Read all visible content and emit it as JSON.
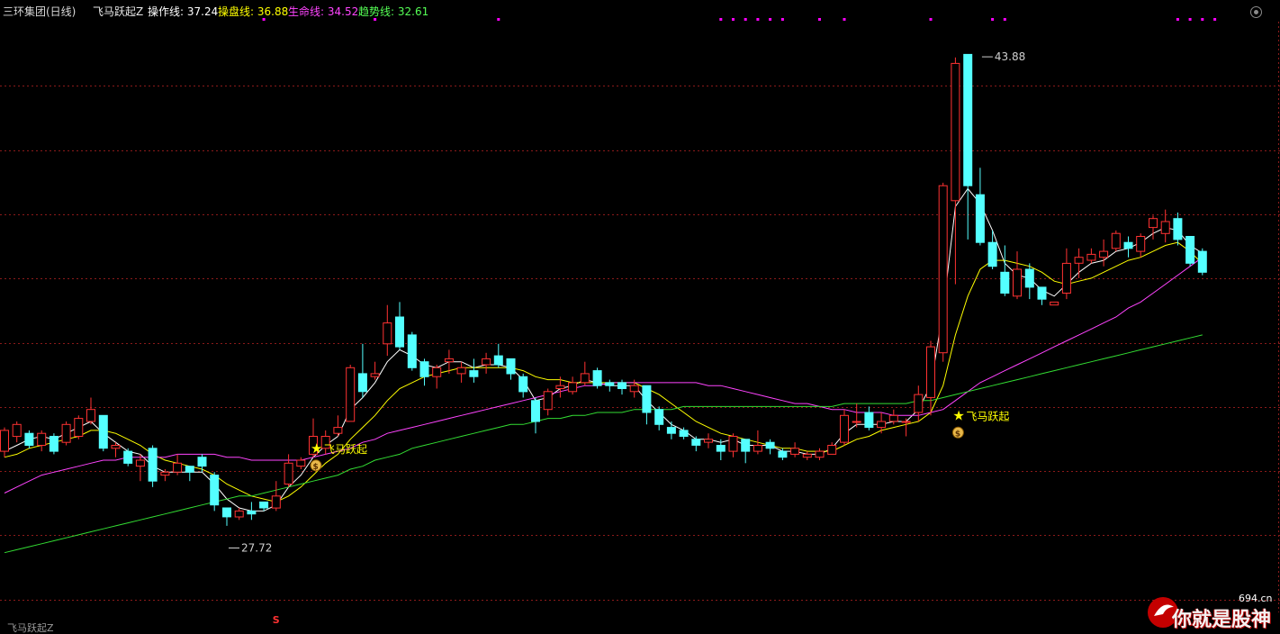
{
  "header": {
    "stock_title": "三环集团(日线)",
    "indicator_title": "飞马跃起Z",
    "op_line": "操作线: 37.24",
    "pan_line": "操盘线: 36.88",
    "life_line": "生命线: 34.52",
    "trend_line": "趋势线: 32.61"
  },
  "bottom_label": "飞马跃起Z",
  "watermark": {
    "text": "你就是股神",
    "domain": "694.cn"
  },
  "colors": {
    "up": "#ff3232",
    "down": "#54ffff",
    "grid": "#8b1a1a",
    "op_line": "#ffffff",
    "pan_line": "#ffff00",
    "life_line": "#ff44ff",
    "trend_line": "#33dd33",
    "signal": "#ffff00",
    "top_dot": "#ff00ff"
  },
  "chart_data": {
    "type": "candlestick",
    "ylim": [
      25.2,
      45.0
    ],
    "high_marker": {
      "label": "43.88",
      "value": 43.88,
      "index": 79
    },
    "low_marker": {
      "label": "27.72",
      "value": 27.72,
      "index": 18
    },
    "signals": [
      {
        "index": 25,
        "label": "飞马跃起",
        "value": 30.7,
        "icon": "star-icon",
        "bag": "money-bag-icon"
      },
      {
        "index": 77,
        "label": "飞马跃起",
        "value": 31.8,
        "icon": "star-icon",
        "bag": "money-bag-icon"
      }
    ],
    "bottom_signal": {
      "index": 22,
      "label": "S"
    },
    "top_dots": [
      21,
      30,
      40,
      58,
      59,
      60,
      61,
      62,
      63,
      66,
      68,
      75,
      80,
      81,
      95,
      96,
      97,
      98
    ],
    "candles": [
      [
        30.6,
        31.3,
        31.4,
        30.4
      ],
      [
        31.1,
        31.5,
        31.6,
        30.9
      ],
      [
        31.2,
        30.8,
        31.3,
        30.7
      ],
      [
        30.8,
        31.2,
        31.3,
        30.6
      ],
      [
        31.1,
        30.6,
        31.2,
        30.5
      ],
      [
        30.9,
        31.5,
        31.6,
        30.8
      ],
      [
        31.1,
        31.7,
        31.8,
        31.0
      ],
      [
        31.6,
        32.0,
        32.4,
        31.5
      ],
      [
        31.8,
        30.7,
        31.8,
        30.6
      ],
      [
        30.7,
        30.8,
        30.9,
        30.4
      ],
      [
        30.6,
        30.2,
        30.7,
        30.1
      ],
      [
        30.1,
        30.3,
        30.5,
        29.6
      ],
      [
        30.7,
        29.6,
        30.8,
        29.4
      ],
      [
        29.8,
        29.9,
        30.0,
        29.6
      ],
      [
        29.9,
        30.2,
        30.5,
        29.8
      ],
      [
        30.1,
        29.9,
        30.1,
        29.6
      ],
      [
        30.4,
        30.1,
        30.5,
        29.9
      ],
      [
        29.8,
        28.8,
        29.9,
        28.6
      ],
      [
        28.7,
        28.4,
        28.7,
        28.1
      ],
      [
        28.4,
        28.6,
        28.7,
        28.3
      ],
      [
        28.6,
        28.5,
        28.9,
        28.3
      ],
      [
        28.9,
        28.7,
        28.9,
        28.6
      ],
      [
        28.7,
        29.1,
        29.6,
        28.6
      ],
      [
        29.5,
        30.2,
        30.5,
        29.4
      ],
      [
        30.1,
        30.3,
        30.4,
        30.0
      ],
      [
        30.5,
        31.1,
        31.7,
        30.4
      ],
      [
        30.7,
        31.1,
        31.3,
        30.5
      ],
      [
        31.2,
        31.4,
        31.8,
        31.1
      ],
      [
        31.6,
        33.4,
        33.5,
        31.6
      ],
      [
        33.2,
        32.6,
        34.2,
        32.4
      ],
      [
        33.1,
        33.2,
        33.6,
        33.0
      ],
      [
        34.2,
        34.9,
        35.5,
        33.8
      ],
      [
        35.1,
        34.1,
        35.6,
        34.0
      ],
      [
        34.5,
        33.4,
        34.6,
        33.3
      ],
      [
        33.6,
        33.1,
        33.7,
        32.8
      ],
      [
        33.1,
        33.4,
        33.5,
        32.7
      ],
      [
        33.6,
        33.7,
        34.0,
        33.2
      ],
      [
        33.2,
        33.4,
        33.6,
        32.9
      ],
      [
        33.3,
        33.1,
        33.7,
        32.9
      ],
      [
        33.5,
        33.7,
        33.9,
        33.2
      ],
      [
        33.8,
        33.5,
        34.2,
        33.4
      ],
      [
        33.7,
        33.2,
        33.7,
        33.0
      ],
      [
        33.1,
        32.6,
        33.2,
        32.4
      ],
      [
        32.3,
        31.6,
        32.4,
        31.2
      ],
      [
        32.0,
        32.6,
        32.7,
        31.8
      ],
      [
        32.7,
        32.8,
        33.1,
        32.4
      ],
      [
        32.6,
        32.9,
        33.1,
        32.5
      ],
      [
        32.9,
        33.2,
        33.6,
        32.8
      ],
      [
        33.3,
        32.8,
        33.4,
        32.7
      ],
      [
        32.9,
        32.8,
        33.0,
        32.6
      ],
      [
        32.9,
        32.7,
        33.0,
        32.5
      ],
      [
        32.6,
        32.8,
        33.0,
        32.4
      ],
      [
        32.8,
        31.9,
        32.8,
        31.5
      ],
      [
        32.0,
        31.5,
        32.1,
        31.3
      ],
      [
        31.4,
        31.2,
        31.6,
        31.0
      ],
      [
        31.3,
        31.1,
        31.4,
        31.0
      ],
      [
        31.0,
        30.8,
        31.1,
        30.6
      ],
      [
        30.9,
        31.0,
        31.2,
        30.7
      ],
      [
        30.8,
        30.6,
        31.0,
        30.3
      ],
      [
        30.6,
        31.1,
        31.2,
        30.4
      ],
      [
        31.0,
        30.6,
        31.0,
        30.2
      ],
      [
        30.6,
        30.8,
        31.3,
        30.5
      ],
      [
        30.9,
        30.7,
        31.0,
        30.5
      ],
      [
        30.6,
        30.4,
        30.7,
        30.3
      ],
      [
        30.5,
        30.7,
        30.9,
        30.4
      ],
      [
        30.4,
        30.5,
        30.6,
        30.3
      ],
      [
        30.4,
        30.6,
        30.7,
        30.3
      ],
      [
        30.5,
        30.8,
        30.9,
        30.5
      ],
      [
        30.9,
        31.8,
        32.0,
        30.8
      ],
      [
        31.6,
        31.6,
        32.2,
        31.4
      ],
      [
        31.9,
        31.4,
        32.1,
        31.3
      ],
      [
        31.4,
        31.6,
        31.9,
        31.2
      ],
      [
        31.6,
        31.8,
        32.0,
        31.5
      ],
      [
        31.6,
        31.6,
        31.7,
        31.1
      ],
      [
        31.9,
        32.5,
        32.8,
        31.6
      ],
      [
        32.4,
        34.1,
        34.3,
        31.8
      ],
      [
        33.9,
        39.5,
        39.6,
        33.6
      ],
      [
        39.0,
        43.6,
        43.8,
        36.2
      ],
      [
        43.9,
        39.5,
        43.88,
        37.7
      ],
      [
        39.2,
        37.6,
        40.1,
        37.5
      ],
      [
        37.6,
        36.8,
        38.0,
        36.7
      ],
      [
        36.6,
        35.9,
        37.5,
        35.8
      ],
      [
        35.8,
        36.7,
        37.3,
        35.7
      ],
      [
        36.7,
        36.1,
        36.9,
        35.7
      ],
      [
        36.1,
        35.7,
        36.1,
        35.5
      ],
      [
        35.5,
        35.6,
        35.6,
        35.5
      ],
      [
        35.9,
        36.9,
        37.4,
        35.7
      ],
      [
        36.9,
        37.1,
        37.4,
        36.4
      ],
      [
        37.0,
        37.2,
        37.4,
        36.9
      ],
      [
        37.1,
        37.3,
        37.7,
        36.8
      ],
      [
        37.4,
        37.9,
        38.0,
        37.3
      ],
      [
        37.6,
        37.4,
        37.8,
        37.1
      ],
      [
        37.3,
        37.8,
        37.9,
        37.1
      ],
      [
        38.1,
        38.4,
        38.5,
        37.7
      ],
      [
        37.9,
        38.3,
        38.7,
        37.6
      ],
      [
        38.4,
        37.7,
        38.6,
        37.5
      ],
      [
        37.8,
        36.9,
        37.8,
        36.8
      ],
      [
        37.3,
        36.6,
        37.4,
        36.5
      ]
    ],
    "series": [
      {
        "name": "操作线",
        "values": [
          30.6,
          30.8,
          31.0,
          31.1,
          31.0,
          31.2,
          31.4,
          31.6,
          31.2,
          30.9,
          30.6,
          30.5,
          30.1,
          29.9,
          29.9,
          29.9,
          29.9,
          29.5,
          29.0,
          28.7,
          28.6,
          28.6,
          28.8,
          29.4,
          29.8,
          30.4,
          30.8,
          31.1,
          32.0,
          32.4,
          32.9,
          33.6,
          34.0,
          33.8,
          33.5,
          33.4,
          33.6,
          33.6,
          33.4,
          33.5,
          33.5,
          33.4,
          33.0,
          32.3,
          32.4,
          32.7,
          32.8,
          33.0,
          32.9,
          32.8,
          32.8,
          32.8,
          32.3,
          31.9,
          31.5,
          31.3,
          31.0,
          31.0,
          30.9,
          31.0,
          30.8,
          30.8,
          30.8,
          30.6,
          30.6,
          30.5,
          30.5,
          30.7,
          31.2,
          31.5,
          31.5,
          31.5,
          31.6,
          31.6,
          32.0,
          32.8,
          35.3,
          38.8,
          39.4,
          38.9,
          38.0,
          36.9,
          36.5,
          36.4,
          36.0,
          35.8,
          36.2,
          36.6,
          36.9,
          37.0,
          37.3,
          37.4,
          37.6,
          37.9,
          38.1,
          38.0,
          37.5,
          37.24
        ]
      },
      {
        "name": "操盘线",
        "values": [
          30.4,
          30.5,
          30.7,
          30.8,
          30.9,
          31.0,
          31.1,
          31.3,
          31.3,
          31.2,
          31.0,
          30.8,
          30.5,
          30.3,
          30.2,
          30.1,
          30.0,
          29.8,
          29.5,
          29.3,
          29.1,
          29.0,
          28.9,
          29.1,
          29.4,
          29.8,
          30.2,
          30.5,
          31.0,
          31.4,
          31.8,
          32.3,
          32.7,
          32.9,
          33.1,
          33.2,
          33.3,
          33.4,
          33.4,
          33.4,
          33.4,
          33.4,
          33.3,
          33.1,
          33.0,
          33.0,
          32.9,
          32.9,
          32.9,
          32.9,
          32.9,
          32.9,
          32.7,
          32.5,
          32.2,
          31.9,
          31.6,
          31.4,
          31.2,
          31.1,
          31.0,
          30.9,
          30.8,
          30.7,
          30.7,
          30.6,
          30.6,
          30.6,
          30.8,
          31.0,
          31.1,
          31.3,
          31.4,
          31.5,
          31.6,
          31.9,
          32.8,
          34.5,
          35.8,
          36.7,
          37.0,
          37.0,
          36.9,
          36.8,
          36.6,
          36.3,
          36.2,
          36.3,
          36.4,
          36.6,
          36.8,
          37.0,
          37.1,
          37.3,
          37.5,
          37.6,
          37.3,
          36.88
        ]
      },
      {
        "name": "生命线",
        "values": [
          29.2,
          29.4,
          29.6,
          29.8,
          29.9,
          30.0,
          30.1,
          30.2,
          30.3,
          30.3,
          30.4,
          30.4,
          30.4,
          30.4,
          30.5,
          30.5,
          30.5,
          30.5,
          30.4,
          30.4,
          30.3,
          30.3,
          30.3,
          30.3,
          30.3,
          30.4,
          30.5,
          30.6,
          30.7,
          30.9,
          31.0,
          31.2,
          31.3,
          31.4,
          31.5,
          31.6,
          31.7,
          31.8,
          31.9,
          32.0,
          32.1,
          32.2,
          32.3,
          32.4,
          32.5,
          32.6,
          32.7,
          32.8,
          32.8,
          32.9,
          32.9,
          32.9,
          32.9,
          32.9,
          32.9,
          32.9,
          32.9,
          32.8,
          32.8,
          32.7,
          32.6,
          32.5,
          32.4,
          32.3,
          32.2,
          32.2,
          32.1,
          32.0,
          32.0,
          31.9,
          31.9,
          31.9,
          31.8,
          31.8,
          31.8,
          31.9,
          32.0,
          32.3,
          32.6,
          32.9,
          33.1,
          33.3,
          33.5,
          33.7,
          33.9,
          34.1,
          34.3,
          34.5,
          34.7,
          34.9,
          35.1,
          35.4,
          35.6,
          35.9,
          36.2,
          36.5,
          36.8,
          37.1
        ]
      },
      {
        "name": "趋势线",
        "values": [
          27.2,
          27.3,
          27.4,
          27.5,
          27.6,
          27.7,
          27.8,
          27.9,
          28.0,
          28.1,
          28.2,
          28.3,
          28.4,
          28.5,
          28.6,
          28.7,
          28.8,
          28.9,
          29.0,
          29.1,
          29.1,
          29.2,
          29.3,
          29.4,
          29.5,
          29.6,
          29.7,
          29.8,
          30.0,
          30.1,
          30.3,
          30.4,
          30.5,
          30.7,
          30.8,
          30.9,
          31.0,
          31.1,
          31.2,
          31.3,
          31.4,
          31.5,
          31.5,
          31.6,
          31.7,
          31.7,
          31.8,
          31.8,
          31.9,
          31.9,
          31.9,
          32.0,
          32.0,
          32.0,
          32.0,
          32.1,
          32.1,
          32.1,
          32.1,
          32.1,
          32.1,
          32.1,
          32.1,
          32.1,
          32.1,
          32.1,
          32.1,
          32.1,
          32.2,
          32.2,
          32.2,
          32.2,
          32.2,
          32.2,
          32.3,
          32.3,
          32.4,
          32.5,
          32.6,
          32.7,
          32.8,
          32.9,
          33.0,
          33.1,
          33.2,
          33.3,
          33.4,
          33.5,
          33.6,
          33.7,
          33.8,
          33.9,
          34.0,
          34.1,
          34.2,
          34.3,
          34.4,
          34.5
        ]
      }
    ]
  }
}
